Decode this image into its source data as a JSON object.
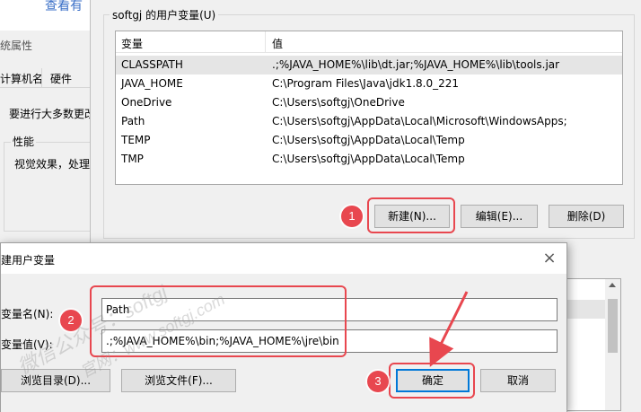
{
  "system_properties": {
    "top_link": "查看有",
    "title": "统属性",
    "tabs": [
      "计算机名",
      "硬件"
    ],
    "admin_text": "要进行大多数更改",
    "performance_group": "性能",
    "performance_text": "视觉效果，处理"
  },
  "env_dialog": {
    "user_group_label": "softgj 的用户变量(U)",
    "columns": [
      "变量",
      "值"
    ],
    "rows": [
      {
        "name": "CLASSPATH",
        "value": ".;%JAVA_HOME%\\lib\\dt.jar;%JAVA_HOME%\\lib\\tools.jar"
      },
      {
        "name": "JAVA_HOME",
        "value": "C:\\Program Files\\Java\\jdk1.8.0_221"
      },
      {
        "name": "OneDrive",
        "value": "C:\\Users\\softgj\\OneDrive"
      },
      {
        "name": "Path",
        "value": "C:\\Users\\softgj\\AppData\\Local\\Microsoft\\WindowsApps;"
      },
      {
        "name": "TEMP",
        "value": "C:\\Users\\softgj\\AppData\\Local\\Temp"
      },
      {
        "name": "TMP",
        "value": "C:\\Users\\softgj\\AppData\\Local\\Temp"
      }
    ],
    "new_button": "新建(N)...",
    "edit_button": "编辑(E)...",
    "delete_button": "删除(D)"
  },
  "new_var_dialog": {
    "title": "建用户变量",
    "close_icon": "×",
    "name_label": "变量名(N):",
    "value_label": "变量值(V):",
    "name_value": "Path",
    "value_value": ".;%JAVA_HOME%\\bin;%JAVA_HOME%\\jre\\bin",
    "browse_dir_button": "浏览目录(D)...",
    "browse_file_button": "浏览文件(F)...",
    "ok_button": "确定",
    "cancel_button": "取消"
  },
  "annotations": {
    "badges": [
      "1",
      "2",
      "3"
    ],
    "accent_color": "#e8474f"
  },
  "watermark": {
    "line1": "微信公众号：softgj",
    "line2": "官网：www.softgj.com"
  }
}
